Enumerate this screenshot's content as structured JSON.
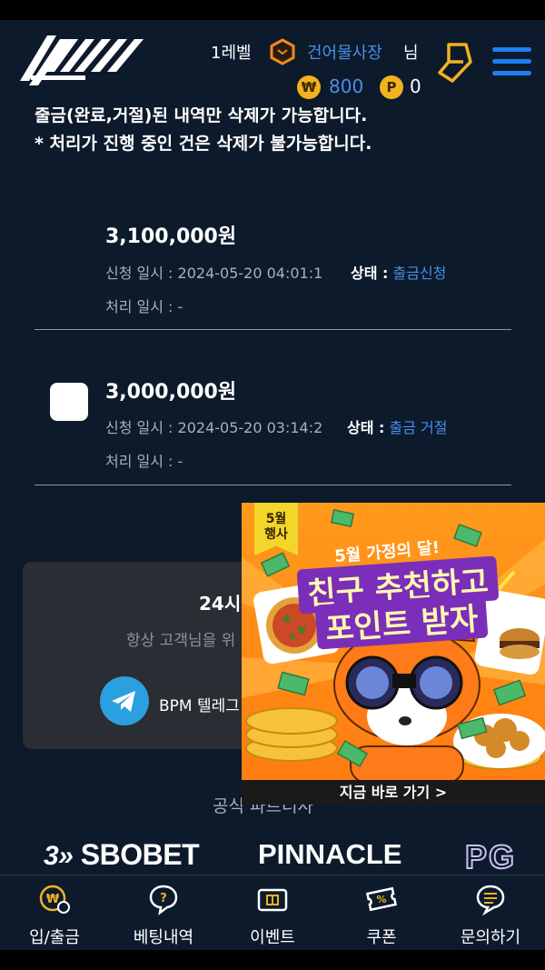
{
  "header": {
    "level": "1레벨",
    "username": "건어물사장",
    "honorific": "님",
    "money": "800",
    "money_symbol": "₩",
    "points": "0",
    "points_symbol": "P"
  },
  "notice": {
    "line1": "출금(완료,거절)된 내역만 삭제가 가능합니다.",
    "line2": "* 처리가 진행 중인 건은 삭제가 불가능합니다."
  },
  "records": [
    {
      "amount": "3,100,000원",
      "request_label": "신청 일시 : 2024-05-20 04:01:1",
      "status_label": "상태 :",
      "status_value": "출금신청",
      "process_label": "처리 일시 : -"
    },
    {
      "amount": "3,000,000원",
      "request_label": "신청 일시 : 2024-05-20 03:14:2",
      "status_label": "상태 :",
      "status_value": "출금 거절",
      "process_label": "처리 일시 : -"
    }
  ],
  "support": {
    "title": "24시",
    "subtitle": "항상 고객님을 위",
    "telegram_label": "BPM 텔레그"
  },
  "partners": {
    "title": "공식 파트너사",
    "logos": [
      "SBOBET",
      "PINNACLE",
      "PG"
    ]
  },
  "promo": {
    "badge": "5월\n행사",
    "subtitle": "5월 가정의 달!",
    "title_line1": "친구 추천하고",
    "title_line2": "포인트 받자",
    "cta": "지금 바로 가기 >"
  },
  "nav": [
    {
      "label": "입/출금",
      "icon": "wallet-icon"
    },
    {
      "label": "베팅내역",
      "icon": "bet-history-icon"
    },
    {
      "label": "이벤트",
      "icon": "gift-icon"
    },
    {
      "label": "쿠폰",
      "icon": "coupon-icon"
    },
    {
      "label": "문의하기",
      "icon": "chat-icon"
    }
  ],
  "colors": {
    "background": "#0c1a2c",
    "accent_blue": "#4a8fe6",
    "menu_blue": "#1e7ff0",
    "coin_gold": "#f2b21e",
    "promo_orange": "#ff8a16"
  }
}
